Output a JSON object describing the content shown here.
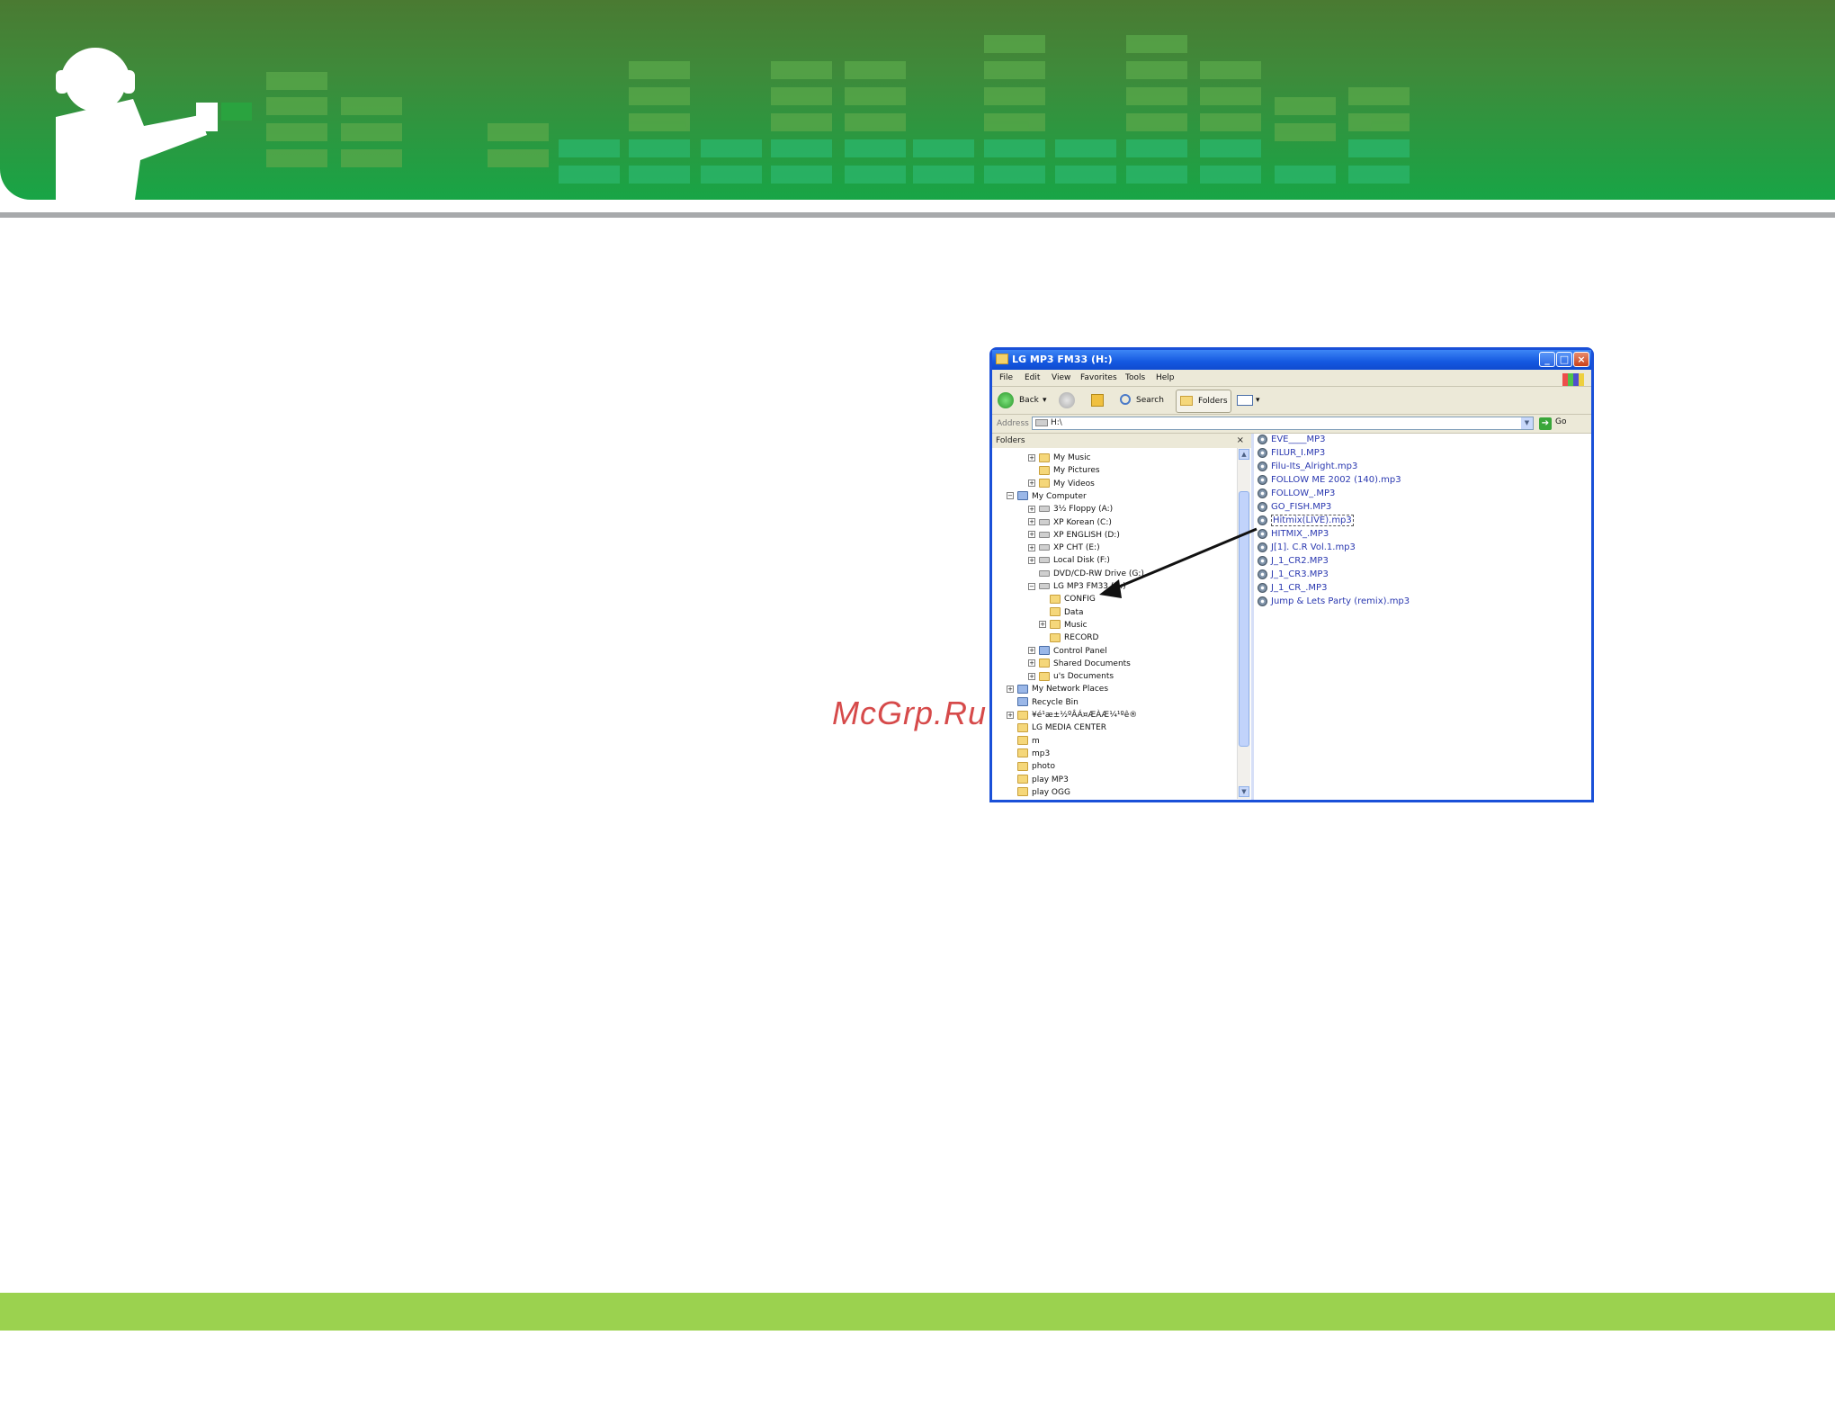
{
  "watermark": "McGrp.Ru",
  "window": {
    "title": "LG MP3 FM33 (H:)",
    "menu": [
      "File",
      "Edit",
      "View",
      "Favorites",
      "Tools",
      "Help"
    ],
    "toolbar": {
      "back": "Back",
      "search": "Search",
      "folders": "Folders"
    },
    "address": {
      "label": "Address",
      "value": "H:\\",
      "go": "Go"
    },
    "folders_pane": {
      "header": "Folders",
      "close": "×",
      "tree": [
        {
          "label": "My Music",
          "expander": "+"
        },
        {
          "label": "My Pictures",
          "expander": ""
        },
        {
          "label": "My Videos",
          "expander": "+"
        },
        {
          "label": "My Computer",
          "expander": "−"
        },
        {
          "label": "3½ Floppy (A:)",
          "expander": "+"
        },
        {
          "label": "XP Korean (C:)",
          "expander": "+"
        },
        {
          "label": "XP ENGLISH (D:)",
          "expander": "+"
        },
        {
          "label": "XP CHT (E:)",
          "expander": "+"
        },
        {
          "label": "Local Disk (F:)",
          "expander": "+"
        },
        {
          "label": "DVD/CD-RW Drive (G:)",
          "expander": ""
        },
        {
          "label": "LG MP3 FM33 (H:)",
          "expander": "−"
        },
        {
          "label": "CONFIG",
          "expander": ""
        },
        {
          "label": "Data",
          "expander": ""
        },
        {
          "label": "Music",
          "expander": "+"
        },
        {
          "label": "RECORD",
          "expander": ""
        },
        {
          "label": "Control Panel",
          "expander": "+"
        },
        {
          "label": "Shared Documents",
          "expander": "+"
        },
        {
          "label": "u's Documents",
          "expander": "+"
        },
        {
          "label": "My Network Places",
          "expander": "+"
        },
        {
          "label": "Recycle Bin",
          "expander": ""
        },
        {
          "label": "¥é¹æ±½ºÂÁ¤ÆÀÆ¼¹ºê®",
          "expander": "+"
        },
        {
          "label": "LG MEDIA CENTER",
          "expander": ""
        },
        {
          "label": "m",
          "expander": ""
        },
        {
          "label": "mp3",
          "expander": ""
        },
        {
          "label": "photo",
          "expander": ""
        },
        {
          "label": "play MP3",
          "expander": ""
        },
        {
          "label": "play OGG",
          "expander": ""
        }
      ]
    },
    "files": [
      "EVE____MP3",
      "FILUR_I.MP3",
      "Filu-Its_Alright.mp3",
      "FOLLOW ME 2002 (140).mp3",
      "FOLLOW_.MP3",
      "GO_FISH.MP3",
      "Hitmix(LIVE).mp3",
      "HITMIX_.MP3",
      "J[1]. C.R Vol.1.mp3",
      "J_1_CR2.MP3",
      "J_1_CR3.MP3",
      "J_1_CR_.MP3",
      "Jump & Lets Party (remix).mp3"
    ]
  }
}
